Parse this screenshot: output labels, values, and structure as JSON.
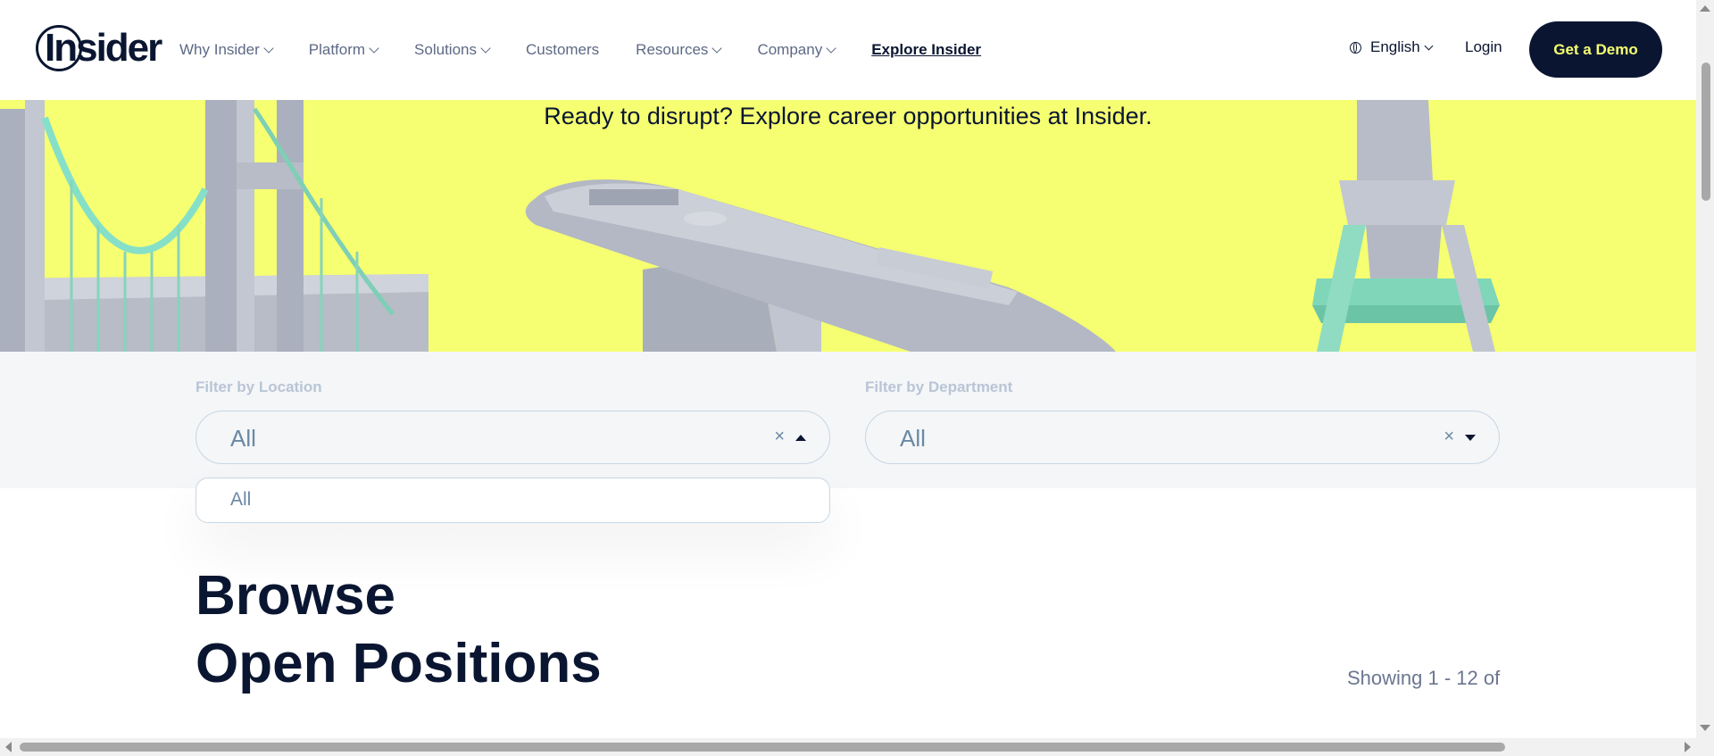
{
  "header": {
    "logo_text": "Insider",
    "nav": [
      {
        "label": "Why Insider",
        "has_dropdown": true
      },
      {
        "label": "Platform",
        "has_dropdown": true
      },
      {
        "label": "Solutions",
        "has_dropdown": true
      },
      {
        "label": "Customers",
        "has_dropdown": false
      },
      {
        "label": "Resources",
        "has_dropdown": true
      },
      {
        "label": "Company",
        "has_dropdown": true
      },
      {
        "label": "Explore Insider",
        "has_dropdown": false
      }
    ],
    "language": "English",
    "login": "Login",
    "cta": "Get a Demo"
  },
  "hero": {
    "tagline": "Ready to disrupt? Explore career opportunities at Insider."
  },
  "filters": {
    "location": {
      "label": "Filter by Location",
      "value": "All",
      "clear": "×",
      "open": true,
      "options": [
        "All"
      ]
    },
    "department": {
      "label": "Filter by Department",
      "value": "All",
      "clear": "×",
      "open": false
    }
  },
  "listing": {
    "heading_line1": "Browse",
    "heading_line2": "Open Positions",
    "showing": "Showing 1 - 12 of"
  },
  "colors": {
    "navy": "#0a1631",
    "hero_yellow": "#f6ff71",
    "filter_bg": "#f4f6f8",
    "muted_text": "#6b88a3"
  }
}
